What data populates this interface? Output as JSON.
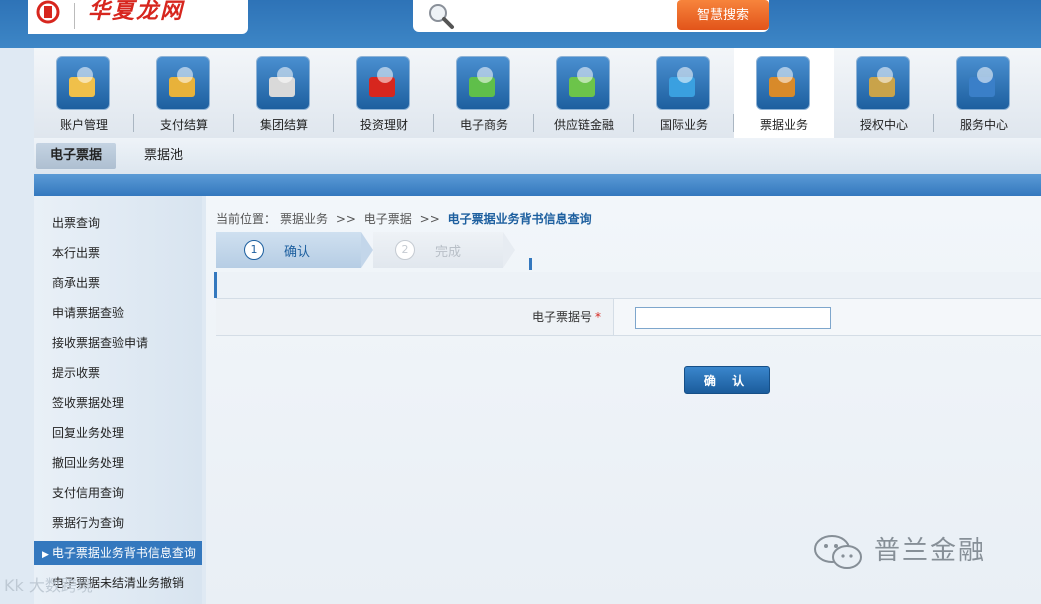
{
  "header": {
    "logo_text": "华夏龙网",
    "search": {
      "placeholder": "",
      "button_label": "智慧搜索"
    }
  },
  "nav": [
    {
      "label": "账户管理",
      "icon": "account-management-icon"
    },
    {
      "label": "支付结算",
      "icon": "payment-settlement-icon"
    },
    {
      "label": "集团结算",
      "icon": "group-settlement-icon"
    },
    {
      "label": "投资理财",
      "icon": "investment-icon"
    },
    {
      "label": "电子商务",
      "icon": "ecommerce-icon"
    },
    {
      "label": "供应链金融",
      "icon": "supply-chain-icon"
    },
    {
      "label": "国际业务",
      "icon": "globe-icon"
    },
    {
      "label": "票据业务",
      "icon": "bill-business-icon",
      "active": true
    },
    {
      "label": "授权中心",
      "icon": "lock-icon"
    },
    {
      "label": "服务中心",
      "icon": "service-person-icon"
    }
  ],
  "subnav": [
    {
      "label": "电子票据",
      "active": true
    },
    {
      "label": "票据池"
    }
  ],
  "sidebar": {
    "items": [
      "出票查询",
      "本行出票",
      "商承出票",
      "申请票据查验",
      "接收票据查验申请",
      "提示收票",
      "签收票据处理",
      "回复业务处理",
      "撤回业务处理",
      "支付信用查询",
      "票据行为查询",
      "电子票据业务背书信息查询",
      "电子票据未结清业务撤销"
    ],
    "active_index": 11
  },
  "breadcrumb": {
    "prefix": "当前位置：",
    "part1": "票据业务",
    "sep": ">>",
    "part2": "电子票据",
    "current": "电子票据业务背书信息查询"
  },
  "steps": [
    {
      "num": "1",
      "label": "确认"
    },
    {
      "num": "2",
      "label": "完成"
    }
  ],
  "form": {
    "bill_number_label": "电子票据号",
    "required_mark": "*",
    "bill_number_value": "",
    "confirm_label": "确 认"
  },
  "watermark": {
    "text": "普兰金融",
    "bottom_text": "Kk 大数跨境"
  },
  "colors": {
    "primary": "#3478be",
    "brand_red": "#d7261e",
    "search_orange": "#e2541a"
  }
}
